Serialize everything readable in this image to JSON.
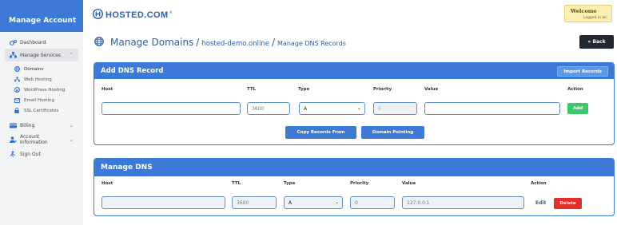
{
  "sidebar": {
    "title": "Manage Account",
    "items": [
      {
        "label": "Dashboard",
        "icon": "gears-icon"
      },
      {
        "label": "Manage Services",
        "icon": "sitemap-icon"
      },
      {
        "label": "Billing",
        "icon": "billing-icon"
      },
      {
        "label": "Account Information",
        "icon": "user-icon"
      },
      {
        "label": "Sign Out",
        "icon": "sign-out-icon"
      }
    ],
    "sub_items": [
      {
        "label": "Domains",
        "icon": "globe-icon"
      },
      {
        "label": "Web Hosting",
        "icon": "sitemap-icon"
      },
      {
        "label": "WordPress Hosting",
        "icon": "wordpress-icon"
      },
      {
        "label": "Email Hosting",
        "icon": "email-icon"
      },
      {
        "label": "SSL Certificates",
        "icon": "lock-icon"
      }
    ]
  },
  "header": {
    "logo_text": "HOSTED.COM",
    "logo_mark": "®",
    "welcome_title": "Welcome",
    "welcome_sub": "Logged in as:"
  },
  "page": {
    "title": "Manage Domains",
    "separator": "/",
    "domain": "hosted-demo.online",
    "section": "Manage DNS Records",
    "back_label": "« Back"
  },
  "add_record": {
    "title": "Add DNS Record",
    "import_label": "Import Records",
    "columns": [
      "Host",
      "TTL",
      "Type",
      "Priority",
      "Value",
      "Action"
    ],
    "host_value": "",
    "ttl_value": "3600",
    "type_value": "A",
    "priority_value": "0",
    "value_value": "",
    "add_label": "Add",
    "copy_label": "Copy Records From",
    "pointing_label": "Domain Pointing"
  },
  "manage_dns": {
    "title": "Manage DNS",
    "columns": [
      "Host",
      "TTL",
      "Type",
      "Priority",
      "Value",
      "Action"
    ],
    "rows": [
      {
        "host": "",
        "ttl": "3600",
        "type": "A",
        "priority": "0",
        "value": "127.0.0.1",
        "edit_label": "Edit",
        "delete_label": "Delete"
      }
    ]
  },
  "colors": {
    "accent": "#3d7ad8",
    "add_button": "#3ec76b",
    "delete_button": "#e0302a",
    "back_button": "#222831",
    "welcome_bg": "#fdeeb3"
  }
}
